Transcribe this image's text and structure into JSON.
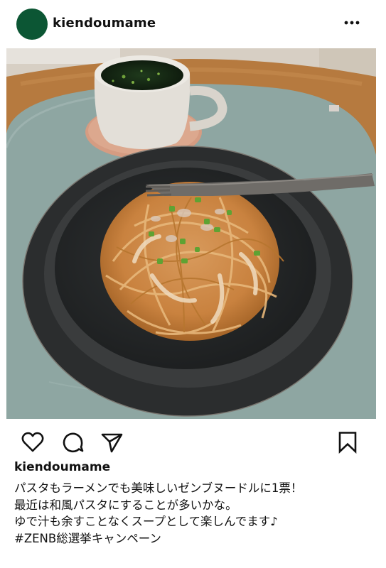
{
  "post": {
    "username": "kiendoumame",
    "owner_name": "kiendoumame",
    "caption_lines": [
      "パスタもラーメンでも美味しいゼンブヌードルに1票！",
      "最近は和風パスタにすることが多いかな。",
      "ゆで汁も余すことなくスープとして楽しんでます♪"
    ],
    "hashtag": "#ZENB総選挙キャンペーン"
  },
  "icons": {
    "more": "more-horizontal-icon",
    "like": "heart-icon",
    "comment": "comment-icon",
    "share": "send-icon",
    "save": "bookmark-icon"
  },
  "colors": {
    "avatar": "#0c5634",
    "text": "#111111"
  }
}
